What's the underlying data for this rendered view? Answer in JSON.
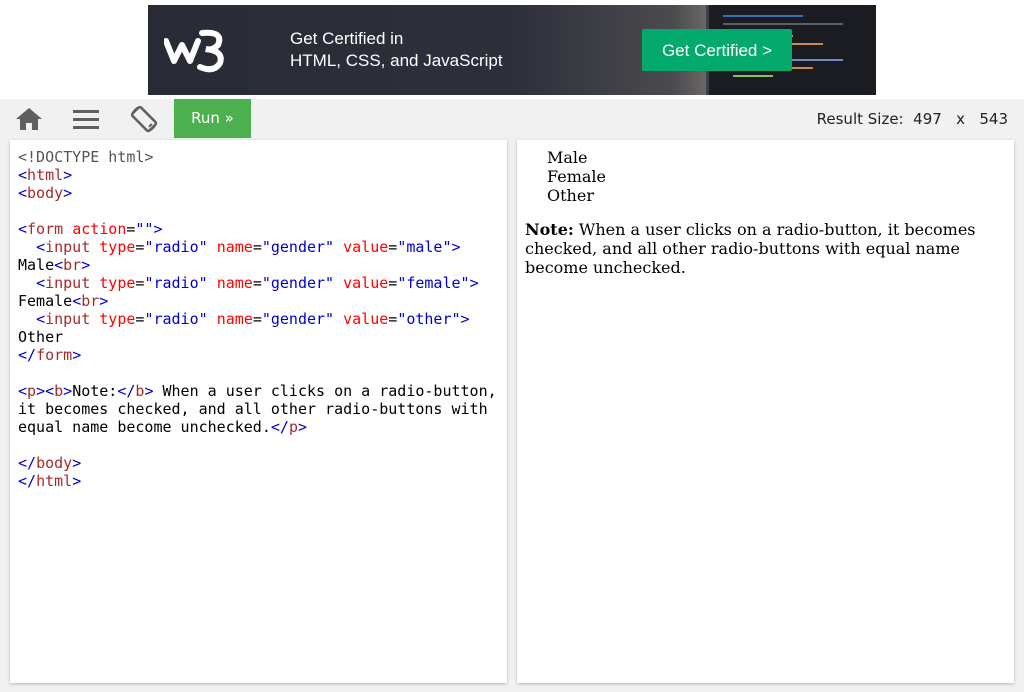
{
  "ad": {
    "line1": "Get Certified in",
    "line2": "HTML, CSS, and JavaScript",
    "cta": "Get Certified >",
    "logo": "w3",
    "colors": {
      "banner": "#282a35",
      "cta": "#04aa6d"
    }
  },
  "toolbar": {
    "run_label": "Run »",
    "result_size_label": "Result Size:",
    "result_width": "497",
    "result_x": "x",
    "result_height": "543",
    "icons": [
      "home-icon",
      "menu-icon",
      "rotate-icon"
    ],
    "colors": {
      "run": "#4caf50",
      "bar": "#f1f1f1"
    }
  },
  "editor": {
    "lines": [
      [
        [
          "meta",
          "<!DOCTYPE html>"
        ]
      ],
      [
        [
          "br",
          "<"
        ],
        [
          "tag",
          "html"
        ],
        [
          "br",
          ">"
        ]
      ],
      [
        [
          "br",
          "<"
        ],
        [
          "tag",
          "body"
        ],
        [
          "br",
          ">"
        ]
      ],
      [],
      [
        [
          "br",
          "<"
        ],
        [
          "tag",
          "form"
        ],
        [
          "text",
          " "
        ],
        [
          "attr",
          "action"
        ],
        [
          "text",
          "="
        ],
        [
          "val",
          "\"\""
        ],
        [
          "br",
          ">"
        ]
      ],
      [
        [
          "text",
          "  "
        ],
        [
          "br",
          "<"
        ],
        [
          "tag",
          "input"
        ],
        [
          "text",
          " "
        ],
        [
          "attr",
          "type"
        ],
        [
          "text",
          "="
        ],
        [
          "val",
          "\"radio\""
        ],
        [
          "text",
          " "
        ],
        [
          "attr",
          "name"
        ],
        [
          "text",
          "="
        ],
        [
          "val",
          "\"gender\""
        ],
        [
          "text",
          " "
        ],
        [
          "attr",
          "value"
        ],
        [
          "text",
          "="
        ],
        [
          "val",
          "\"male\""
        ],
        [
          "br",
          ">"
        ]
      ],
      [
        [
          "text",
          "Male"
        ],
        [
          "br",
          "<"
        ],
        [
          "tag",
          "br"
        ],
        [
          "br",
          ">"
        ]
      ],
      [
        [
          "text",
          "  "
        ],
        [
          "br",
          "<"
        ],
        [
          "tag",
          "input"
        ],
        [
          "text",
          " "
        ],
        [
          "attr",
          "type"
        ],
        [
          "text",
          "="
        ],
        [
          "val",
          "\"radio\""
        ],
        [
          "text",
          " "
        ],
        [
          "attr",
          "name"
        ],
        [
          "text",
          "="
        ],
        [
          "val",
          "\"gender\""
        ],
        [
          "text",
          " "
        ],
        [
          "attr",
          "value"
        ],
        [
          "text",
          "="
        ],
        [
          "val",
          "\"female\""
        ],
        [
          "br",
          ">"
        ]
      ],
      [
        [
          "text",
          "Female"
        ],
        [
          "br",
          "<"
        ],
        [
          "tag",
          "br"
        ],
        [
          "br",
          ">"
        ]
      ],
      [
        [
          "text",
          "  "
        ],
        [
          "br",
          "<"
        ],
        [
          "tag",
          "input"
        ],
        [
          "text",
          " "
        ],
        [
          "attr",
          "type"
        ],
        [
          "text",
          "="
        ],
        [
          "val",
          "\"radio\""
        ],
        [
          "text",
          " "
        ],
        [
          "attr",
          "name"
        ],
        [
          "text",
          "="
        ],
        [
          "val",
          "\"gender\""
        ],
        [
          "text",
          " "
        ],
        [
          "attr",
          "value"
        ],
        [
          "text",
          "="
        ],
        [
          "val",
          "\"other\""
        ],
        [
          "br",
          ">"
        ]
      ],
      [
        [
          "text",
          "Other"
        ]
      ],
      [
        [
          "br",
          "</"
        ],
        [
          "tag",
          "form"
        ],
        [
          "br",
          ">"
        ]
      ],
      [],
      [
        [
          "br",
          "<"
        ],
        [
          "tag",
          "p"
        ],
        [
          "br",
          "><"
        ],
        [
          "tag",
          "b"
        ],
        [
          "br",
          ">"
        ],
        [
          "text",
          "Note:"
        ],
        [
          "br",
          "</"
        ],
        [
          "tag",
          "b"
        ],
        [
          "br",
          ">"
        ],
        [
          "text",
          " When a user clicks on a radio-button,"
        ]
      ],
      [
        [
          "text",
          "it becomes checked, and all other radio-buttons with"
        ]
      ],
      [
        [
          "text",
          "equal name become unchecked."
        ],
        [
          "br",
          "</"
        ],
        [
          "tag",
          "p"
        ],
        [
          "br",
          ">"
        ]
      ],
      [],
      [
        [
          "br",
          "</"
        ],
        [
          "tag",
          "body"
        ],
        [
          "br",
          ">"
        ]
      ],
      [
        [
          "br",
          "</"
        ],
        [
          "tag",
          "html"
        ],
        [
          "br",
          ">"
        ]
      ]
    ]
  },
  "result": {
    "options": [
      {
        "label": "Male",
        "value": "male"
      },
      {
        "label": "Female",
        "value": "female"
      },
      {
        "label": "Other",
        "value": "other"
      }
    ],
    "note_label": "Note:",
    "note_text": " When a user clicks on a radio-button, it becomes checked, and all other radio-buttons with equal name become unchecked."
  }
}
